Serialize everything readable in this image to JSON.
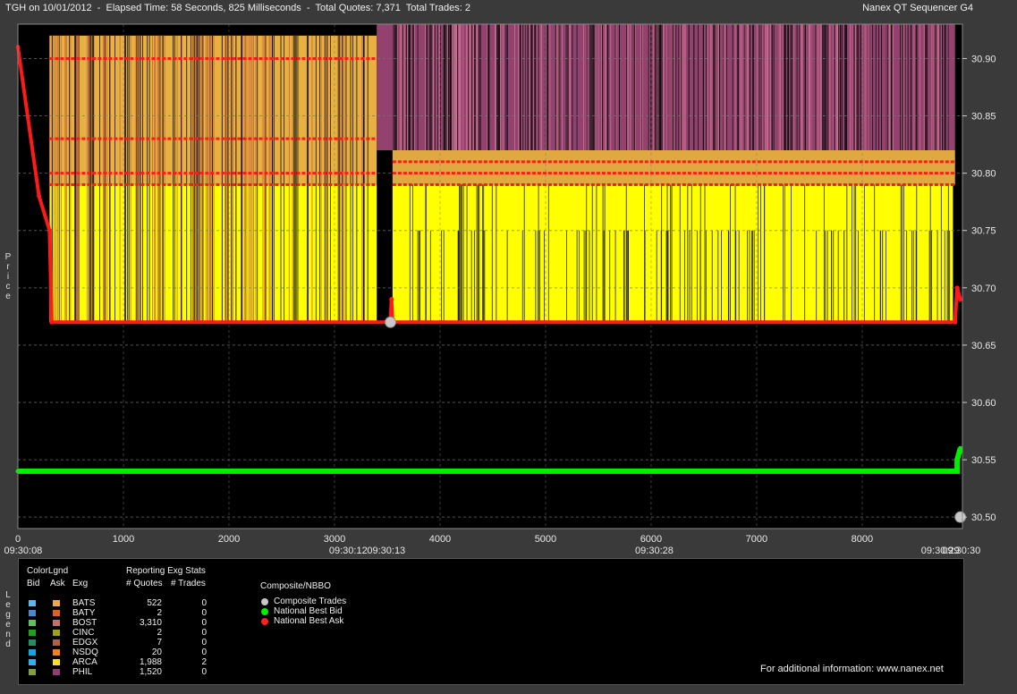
{
  "header": {
    "title": "TGH on 10/01/2012  -  Elapsed Time: 58 Seconds, 825 Milliseconds  -  Total Quotes: 7,371  Total Trades: 2",
    "app_name": "Nanex QT Sequencer G4"
  },
  "axis": {
    "ylabel": "Price",
    "y_ticks": [
      "30.90",
      "30.85",
      "30.80",
      "30.75",
      "30.70",
      "30.65",
      "30.60",
      "30.55",
      "30.50"
    ],
    "x_ticks": [
      "0",
      "1000",
      "2000",
      "3000",
      "4000",
      "5000",
      "6000",
      "7000",
      "8000"
    ],
    "time_labels": [
      "09:30:08",
      "09:30:12",
      "09:30:13",
      "09:30:28",
      "09:30:29",
      "09:30:30"
    ]
  },
  "chart_data": {
    "type": "line",
    "ylim": [
      30.49,
      30.93
    ],
    "xlim": [
      0,
      8950
    ],
    "grid": true,
    "series": [
      {
        "name": "National Best Bid",
        "color": "#00ee00",
        "x": [
          0,
          8900,
          8900,
          8930
        ],
        "y": [
          30.54,
          30.54,
          30.55,
          30.56
        ]
      },
      {
        "name": "National Best Ask",
        "color": "#ff1a1a",
        "x": [
          0,
          200,
          300,
          320,
          3530,
          3540,
          3550,
          8880,
          8900,
          8930
        ],
        "y": [
          30.91,
          30.78,
          30.75,
          30.67,
          30.67,
          30.69,
          30.67,
          30.67,
          30.7,
          30.69
        ]
      },
      {
        "name": "Composite Trades",
        "color": "#c8c8c8",
        "x": [
          3530,
          8930
        ],
        "y": [
          30.67,
          30.5
        ]
      }
    ],
    "quote_bands": [
      {
        "x0": 300,
        "x1": 3400,
        "y0": 30.67,
        "y1": 30.79,
        "color": "#ffff00"
      },
      {
        "x0": 300,
        "x1": 3400,
        "y0": 30.79,
        "y1": 30.92,
        "color": "#e8b040"
      },
      {
        "x0": 3550,
        "x1": 8860,
        "y0": 30.67,
        "y1": 30.79,
        "color": "#ffff00"
      },
      {
        "x0": 3550,
        "x1": 8880,
        "y0": 30.79,
        "y1": 30.82,
        "color": "#e0a840"
      },
      {
        "x0": 3400,
        "x1": 8880,
        "y0": 30.82,
        "y1": 30.93,
        "color": "#93416e"
      }
    ],
    "ask_levels": [
      {
        "x0": 300,
        "x1": 3400,
        "y": 30.9
      },
      {
        "x0": 300,
        "x1": 3400,
        "y": 30.83
      },
      {
        "x0": 300,
        "x1": 3400,
        "y": 30.8
      },
      {
        "x0": 300,
        "x1": 3400,
        "y": 30.79
      },
      {
        "x0": 3550,
        "x1": 8880,
        "y": 30.81
      },
      {
        "x0": 3550,
        "x1": 8880,
        "y": 30.8
      },
      {
        "x0": 3550,
        "x1": 8880,
        "y": 30.79
      }
    ]
  },
  "legend": {
    "title": "ColorLgnd",
    "vertical_label": "Legend",
    "col_bid": "Bid",
    "col_ask": "Ask",
    "col_exg": "Exg",
    "stats_title": "Reporting Exg Stats",
    "col_quotes": "# Quotes",
    "col_trades": "# Trades",
    "composite_title": "Composite/NBBO",
    "rows": [
      {
        "exg": "BATS",
        "quotes": "522",
        "trades": "0",
        "bid_color": "#5bb8e8",
        "ask_color": "#f0a850"
      },
      {
        "exg": "BATY",
        "quotes": "2",
        "trades": "0",
        "bid_color": "#4a88c8",
        "ask_color": "#e06020"
      },
      {
        "exg": "BOST",
        "quotes": "3,310",
        "trades": "0",
        "bid_color": "#60c060",
        "ask_color": "#c07070"
      },
      {
        "exg": "CINC",
        "quotes": "2",
        "trades": "0",
        "bid_color": "#20a020",
        "ask_color": "#a0a020"
      },
      {
        "exg": "EDGX",
        "quotes": "7",
        "trades": "0",
        "bid_color": "#209060",
        "ask_color": "#b06040"
      },
      {
        "exg": "NSDQ",
        "quotes": "20",
        "trades": "0",
        "bid_color": "#20a0e0",
        "ask_color": "#f08020"
      },
      {
        "exg": "ARCA",
        "quotes": "1,988",
        "trades": "2",
        "bid_color": "#30b0f0",
        "ask_color": "#ffe020"
      },
      {
        "exg": "PHIL",
        "quotes": "1,520",
        "trades": "0",
        "bid_color": "#80a040",
        "ask_color": "#904070"
      }
    ],
    "composite_items": [
      {
        "label": "Composite Trades",
        "color": "#c8c8c8"
      },
      {
        "label": "National Best Bid",
        "color": "#00ee00"
      },
      {
        "label": "National Best Ask",
        "color": "#ff2020"
      }
    ],
    "footer": "For additional information: www.nanex.net"
  }
}
